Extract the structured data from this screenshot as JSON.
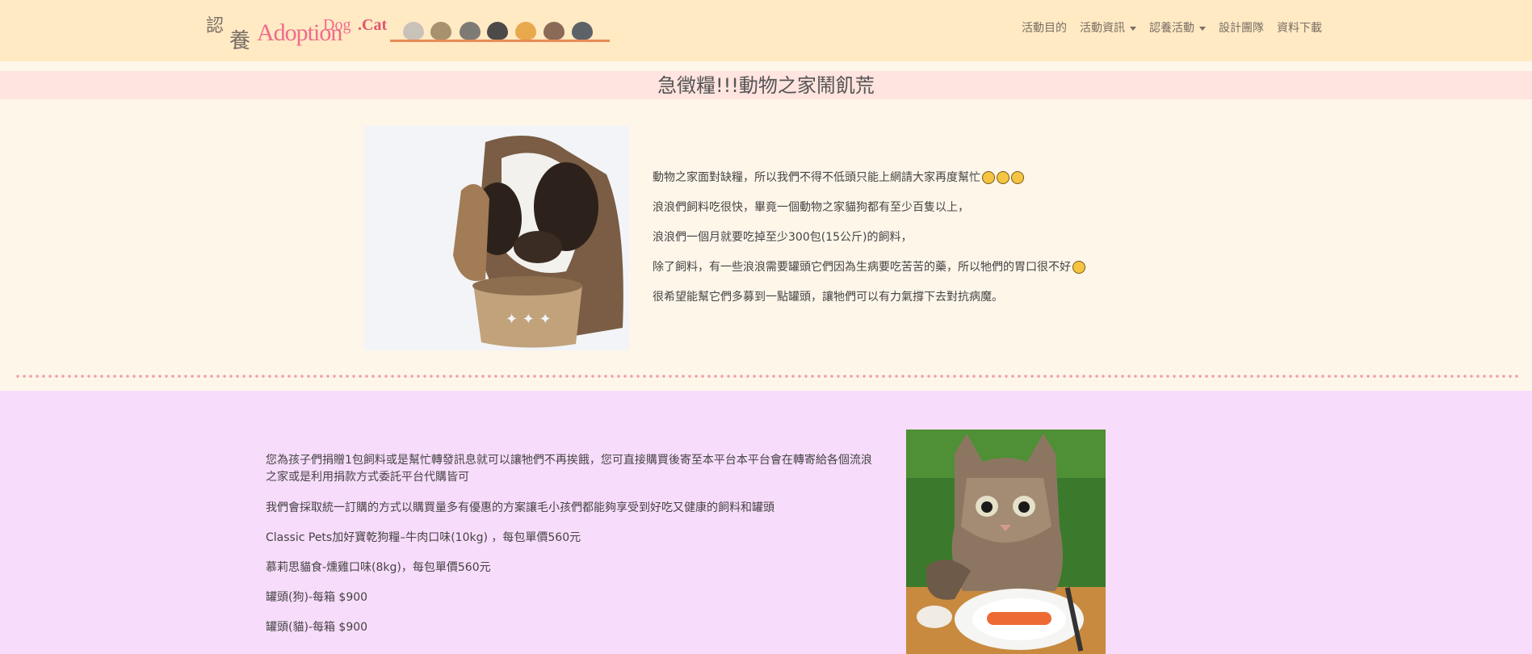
{
  "logo": {
    "char1": "認",
    "char2": "養",
    "word1": "Adoption",
    "word2": "Dog",
    "word3": ".Cat"
  },
  "nav": {
    "items": [
      {
        "label": "活動目的",
        "dropdown": false
      },
      {
        "label": "活動資訊",
        "dropdown": true
      },
      {
        "label": "認養活動",
        "dropdown": true
      },
      {
        "label": "設計團隊",
        "dropdown": false
      },
      {
        "label": "資料下載",
        "dropdown": false
      }
    ]
  },
  "title": "急徵糧!!!動物之家鬧飢荒",
  "section1": {
    "paragraphs": [
      "動物之家面對缺糧，所以我們不得不低頭只能上網請大家再度幫忙",
      "浪浪們飼料吃很快，畢竟一個動物之家貓狗都有至少百隻以上，",
      "浪浪們一個月就要吃掉至少300包(15公斤)的飼料，",
      "除了飼料，有一些浪浪需要罐頭它們因為生病要吃苦苦的藥，所以牠們的胃口很不好",
      "很希望能幫它們多募到一點罐頭，讓牠們可以有力氣撐下去對抗病魔。"
    ]
  },
  "section2": {
    "paragraphs": [
      "您為孩子們捐贈1包飼料或是幫忙轉發訊息就可以讓牠們不再挨餓，您可直接購買後寄至本平台本平台會在轉寄給各個流浪之家或是利用捐款方式委託平台代購皆可",
      "我們會採取統一訂購的方式以購買量多有優惠的方案讓毛小孩們都能夠享受到好吃又健康的飼料和罐頭",
      "Classic Pets加好寶乾狗糧–牛肉口味(10kg) ，每包單價560元",
      "慕莉思貓食-燻雞口味(8kg)，每包單價560元",
      "罐頭(狗)-每箱 $900",
      "罐頭(貓)-每箱 $900"
    ]
  },
  "colors": {
    "navbar": "#ffeac3",
    "page": "#fff6ea",
    "title_band": "#ffe4df",
    "section2": "#f8dcfb",
    "logo_pink": "#f06b8e"
  },
  "icons": [
    "sad-face-emoji-icon",
    "cat-head-icon",
    "dropdown-caret-icon"
  ]
}
